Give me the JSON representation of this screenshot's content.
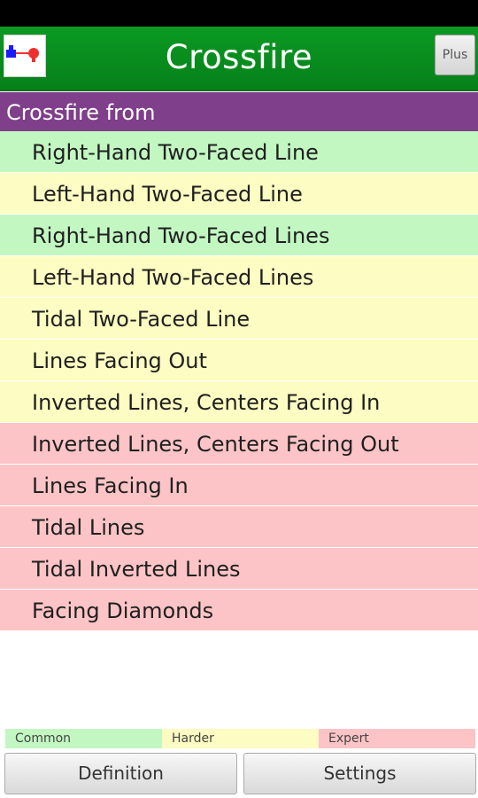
{
  "app": {
    "title": "Crossfire",
    "plus_label": "Plus"
  },
  "section": {
    "header": "Crossfire from"
  },
  "items": [
    {
      "label": "Right-Hand Two-Faced Line",
      "level": "common"
    },
    {
      "label": "Left-Hand Two-Faced Line",
      "level": "harder"
    },
    {
      "label": "Right-Hand Two-Faced Lines",
      "level": "common"
    },
    {
      "label": "Left-Hand Two-Faced Lines",
      "level": "harder"
    },
    {
      "label": "Tidal Two-Faced Line",
      "level": "harder"
    },
    {
      "label": "Lines Facing Out",
      "level": "harder"
    },
    {
      "label": "Inverted Lines, Centers Facing In",
      "level": "harder"
    },
    {
      "label": "Inverted Lines, Centers Facing Out",
      "level": "expert"
    },
    {
      "label": "Lines Facing In",
      "level": "expert"
    },
    {
      "label": "Tidal Lines",
      "level": "expert"
    },
    {
      "label": "Tidal Inverted Lines",
      "level": "expert"
    },
    {
      "label": "Facing Diamonds",
      "level": "expert"
    }
  ],
  "legend": {
    "common": "Common",
    "harder": "Harder",
    "expert": "Expert"
  },
  "buttons": {
    "definition": "Definition",
    "settings": "Settings"
  },
  "colors": {
    "title_bar": "#0b9a22",
    "section_header": "#7f3f8a",
    "common": "#c2f7c2",
    "harder": "#fdfcc2",
    "expert": "#fcc4c6"
  },
  "icons": {
    "app_icon": "dancers-icon"
  }
}
